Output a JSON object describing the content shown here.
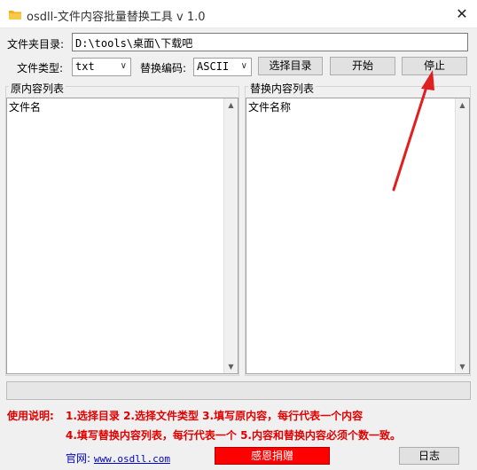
{
  "window": {
    "title": "osdll-文件内容批量替换工具 v 1.0",
    "close_glyph": "✕"
  },
  "folder": {
    "label": "文件夹目录:",
    "value": "D:\\tools\\桌面\\下载吧"
  },
  "filetype": {
    "label": "文件类型:",
    "value": "txt"
  },
  "encoding": {
    "label": "替换编码:",
    "value": "ASCII"
  },
  "buttons": {
    "select_dir": "选择目录",
    "start": "开始",
    "stop": "停止"
  },
  "left_panel": {
    "title": "原内容列表",
    "content": "文件名"
  },
  "right_panel": {
    "title": "替换内容列表",
    "content": "文件名称"
  },
  "progress": {
    "value": 0
  },
  "instructions": {
    "label": "使用说明:",
    "line1": "1.选择目录    2.选择文件类型    3.填写原内容，每行代表一个内容",
    "line2": "4.填写替换内容列表，每行代表一个    5.内容和替换内容必须个数一致。"
  },
  "footer": {
    "site_label": "官网:",
    "site_url": "www.osdll.com",
    "donate": "感恩捐赠",
    "log": "日志"
  },
  "colors": {
    "arrow": "#e02020",
    "accent_red": "#ff0000",
    "link": "#0000cc"
  }
}
